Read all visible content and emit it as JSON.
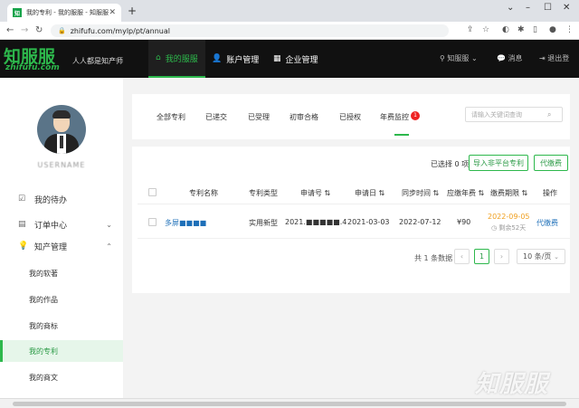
{
  "browser": {
    "tab_title": "我的专利 - 我的服服 - 知服服",
    "favicon": "知",
    "url": "zhifufu.com/mylp/pt/annual"
  },
  "header": {
    "logo_text": "知服服",
    "logo_sub": "zhifufu.com",
    "slogan": "人人都是知产师",
    "nav": [
      {
        "label": "我的服服",
        "icon": "home-icon",
        "active": true
      },
      {
        "label": "账户管理",
        "icon": "user-icon",
        "active": false
      },
      {
        "label": "企业管理",
        "icon": "building-icon",
        "active": false
      }
    ],
    "right": {
      "service": "知服服",
      "messages": "消息",
      "logout": "退出登"
    },
    "accent_color": "#2db84c"
  },
  "sidebar": {
    "username": "USERNAME",
    "menu": [
      {
        "label": "我的待办",
        "icon": "todo-icon",
        "expandable": false
      },
      {
        "label": "订单中心",
        "icon": "order-icon",
        "expandable": true,
        "expanded": false
      },
      {
        "label": "知产管理",
        "icon": "bulb-icon",
        "expandable": true,
        "expanded": true
      }
    ],
    "sub_items": [
      {
        "label": "我的软著",
        "active": false
      },
      {
        "label": "我的作品",
        "active": false
      },
      {
        "label": "我的商标",
        "active": false
      },
      {
        "label": "我的专利",
        "active": true
      },
      {
        "label": "我的商文",
        "active": false
      }
    ]
  },
  "filters": {
    "tabs": [
      "全部专利",
      "已递交",
      "已受理",
      "初审合格",
      "已授权",
      "年费监控"
    ],
    "active_tab": "年费监控",
    "badge": "1",
    "search_placeholder": "请输入关键词查询"
  },
  "toolbar": {
    "selected": "已选择 0 项",
    "import_btn": "导入非平台专利",
    "pay_btn": "代缴费"
  },
  "table": {
    "headers": [
      "专利名称",
      "专利类型",
      "申请号",
      "申请日",
      "同步时间",
      "应缴年费",
      "缴费期限",
      "操作"
    ],
    "rows": [
      {
        "name": "多屏■■■■",
        "type": "实用新型",
        "app_no": "2021.■■■■■.4",
        "app_date": "2021-03-03",
        "sync": "2022-07-12",
        "fee": "¥90",
        "deadline": "2022-09-05",
        "remaining": "剩余52天",
        "action": "代缴费"
      }
    ]
  },
  "pagination": {
    "total": "共 1 条数据",
    "current": "1",
    "page_size": "10 条/页"
  },
  "watermark": "知服服"
}
